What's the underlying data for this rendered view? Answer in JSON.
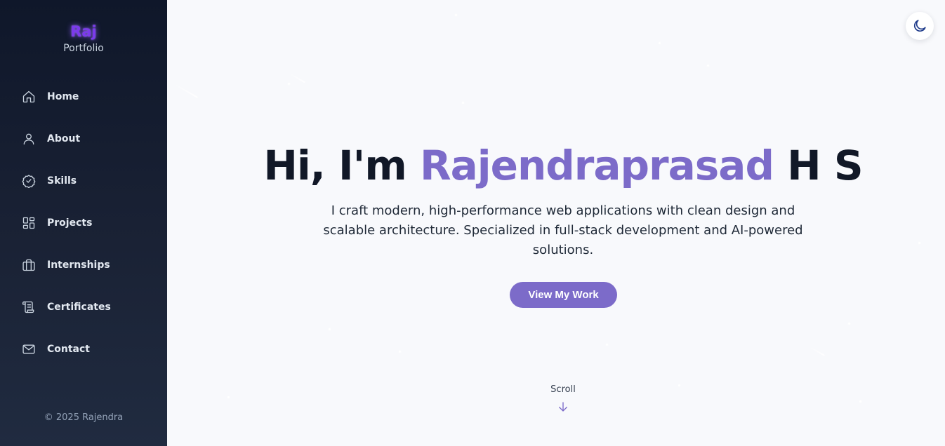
{
  "sidebar": {
    "brand_name": "Raj",
    "brand_sub": "Portfolio",
    "items": [
      {
        "label": "Home",
        "icon": "home-icon"
      },
      {
        "label": "About",
        "icon": "user-icon"
      },
      {
        "label": "Skills",
        "icon": "badge-check-icon"
      },
      {
        "label": "Projects",
        "icon": "grid-icon"
      },
      {
        "label": "Internships",
        "icon": "briefcase-icon"
      },
      {
        "label": "Certificates",
        "icon": "scroll-icon"
      },
      {
        "label": "Contact",
        "icon": "mail-icon"
      }
    ],
    "copyright": "© 2025 Rajendra"
  },
  "hero": {
    "title_prefix": "Hi, I'm ",
    "title_highlight": "Rajendraprasad",
    "title_suffix": " H S",
    "description": "I craft modern, high-performance web applications with clean design and scalable architecture. Specialized in full-stack development and AI-powered solutions.",
    "cta_label": "View My Work",
    "scroll_label": "Scroll"
  },
  "theme_toggle": {
    "icon": "moon-icon"
  },
  "colors": {
    "accent": "#7c6bc9",
    "brand": "#7c3aed",
    "sidebar_bg": "#0f172a",
    "page_bg": "#f8f9fc"
  }
}
